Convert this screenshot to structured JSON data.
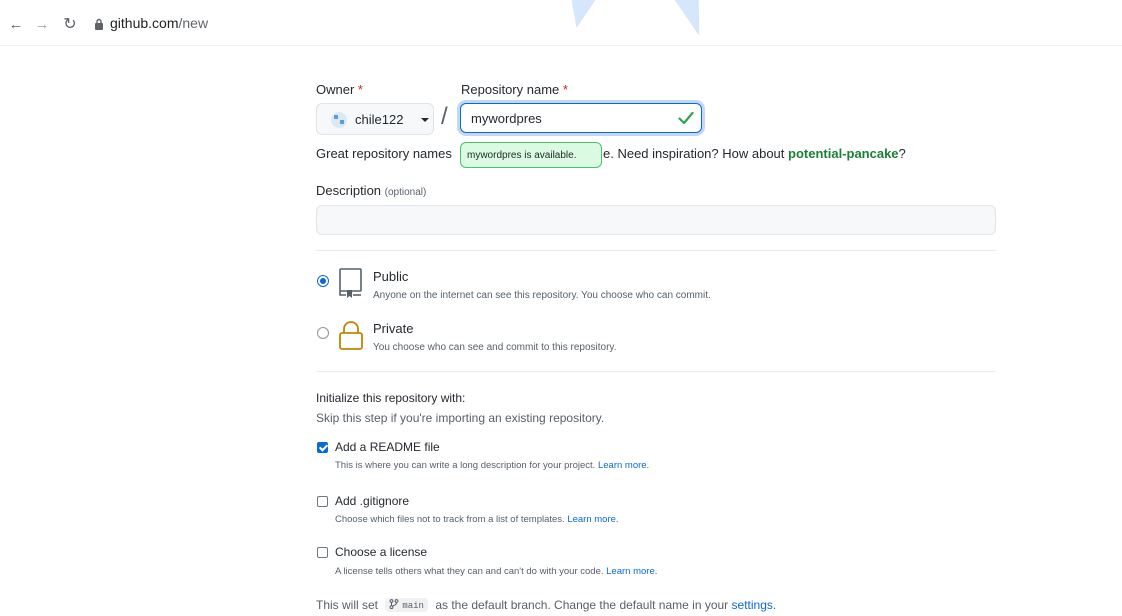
{
  "browser": {
    "url_host": "github.com",
    "url_path": "/new",
    "icons": [
      "back-arrow-icon",
      "forward-arrow-icon",
      "reload-icon",
      "lock-icon"
    ]
  },
  "form": {
    "owner_label": "Owner",
    "repo_label": "Repository name",
    "required_mark": "*",
    "owner_value": "chile122",
    "slash": "/",
    "repo_value": "mywordpres",
    "availability": "mywordpres is available.",
    "hint_prefix": "Great repository names ",
    "hint_middle": "e. Need inspiration? How about ",
    "hint_suggestion": "potential-pancake",
    "hint_suffix": "?",
    "description_label": "Description",
    "description_optional": "(optional)",
    "description_value": ""
  },
  "visibility": {
    "options": [
      {
        "title": "Public",
        "desc": "Anyone on the internet can see this repository. You choose who can commit.",
        "selected": true
      },
      {
        "title": "Private",
        "desc": "You choose who can see and commit to this repository.",
        "selected": false
      }
    ]
  },
  "init": {
    "title": "Initialize this repository with:",
    "subtitle": "Skip this step if you're importing an existing repository.",
    "options": [
      {
        "title": "Add a README file",
        "desc": "This is where you can write a long description for your project.",
        "link": "Learn more.",
        "checked": true
      },
      {
        "title": "Add .gitignore",
        "desc": "Choose which files not to track from a list of templates.",
        "link": "Learn more.",
        "checked": false
      },
      {
        "title": "Choose a license",
        "desc": "A license tells others what they can and can't do with your code.",
        "link": "Learn more.",
        "checked": false
      }
    ]
  },
  "branch": {
    "prefix": "This will set",
    "name": "main",
    "middle": "as the default branch. Change the default name in your",
    "link": "settings",
    "suffix": "."
  },
  "colors": {
    "accent": "#0969da",
    "success": "#1a7f37",
    "required": "#cf222e",
    "private_lock": "#bf8700"
  }
}
